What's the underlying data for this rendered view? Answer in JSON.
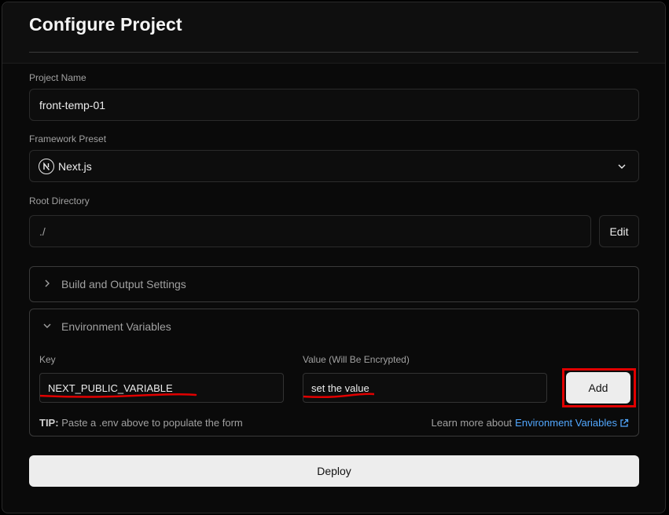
{
  "header": {
    "title": "Configure Project"
  },
  "project_name": {
    "label": "Project Name",
    "value": "front-temp-01"
  },
  "framework": {
    "label": "Framework Preset",
    "value": "Next.js",
    "logo_letter": "N",
    "icon": "chevron-down-icon"
  },
  "root_directory": {
    "label": "Root Directory",
    "value": "./",
    "edit_label": "Edit"
  },
  "build_settings": {
    "label": "Build and Output Settings",
    "icon": "chevron-right-icon"
  },
  "env_vars": {
    "label": "Environment Variables",
    "icon": "chevron-down-icon",
    "key_label": "Key",
    "value_label": "Value (Will Be Encrypted)",
    "key_value": "NEXT_PUBLIC_VARIABLE",
    "value_value": "set the value",
    "add_label": "Add",
    "tip_prefix": "TIP:",
    "tip_text": "Paste a .env above to populate the form",
    "learn_text": "Learn more about",
    "learn_link": "Environment Variables",
    "highlight_color": "#e10000",
    "link_color": "#52a8ff"
  },
  "deploy": {
    "label": "Deploy"
  }
}
